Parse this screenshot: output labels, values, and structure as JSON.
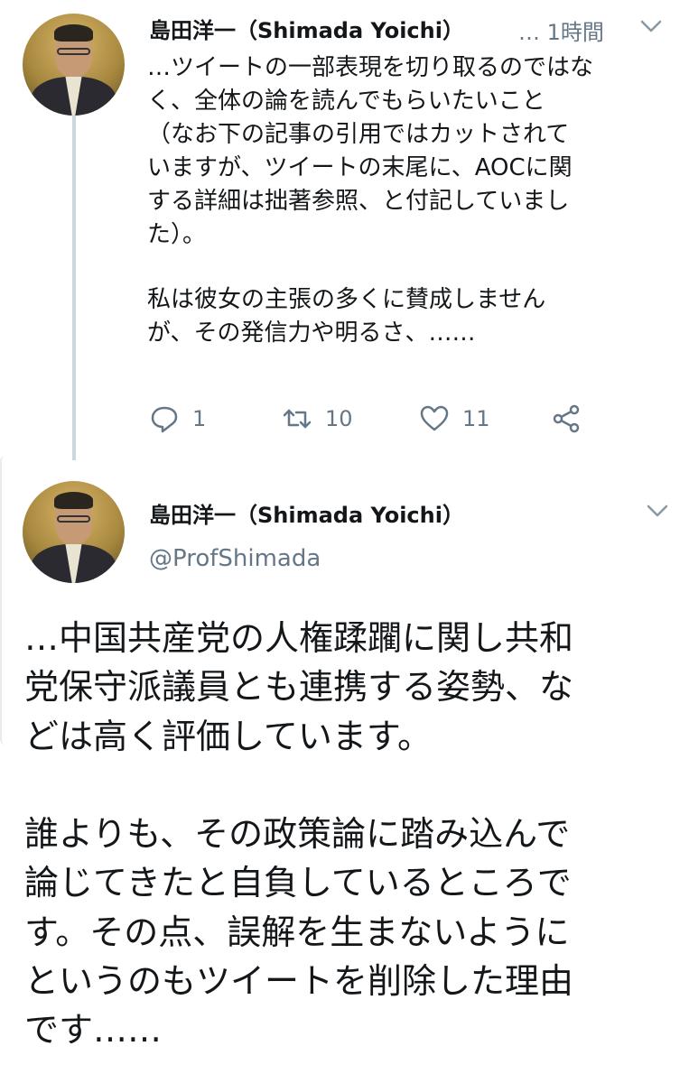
{
  "tweet1": {
    "author_name": "島田洋一（Shimada Yoichi）",
    "meta": "… 1時間",
    "paragraph1": "…ツイートの一部表現を切り取るのではな\nく、全体の論を読んでもらいたいこと\n（なお下の記事の引用ではカットされて\nいますが、ツイートの末尾に、AOCに関\nする詳細は拙著参照、と付記していまし\nた）。",
    "paragraph2": "私は彼女の主張の多くに賛成しません\nが、その発信力や明るさ、……",
    "reply_count": "1",
    "retweet_count": "10",
    "like_count": "11",
    "icons": [
      "reply-icon",
      "retweet-icon",
      "like-icon",
      "share-icon",
      "chevron-down-icon"
    ]
  },
  "tweet2": {
    "author_name": "島田洋一（Shimada Yoichi）",
    "handle": "@ProfShimada",
    "paragraph1": "…中国共産党の人権蹂躙に関し共和\n党保守派議員とも連携する姿勢、な\nどは高く評価しています。",
    "paragraph2": "誰よりも、その政策論に踏み込んで\n論じてきたと自負しているところで\nす。その点、誤解を生まないように\nというのもツイートを削除した理由\nです……"
  },
  "colors": {
    "text": "#14171a",
    "secondary": "#657786",
    "thread_line": "#ccd6dd"
  }
}
